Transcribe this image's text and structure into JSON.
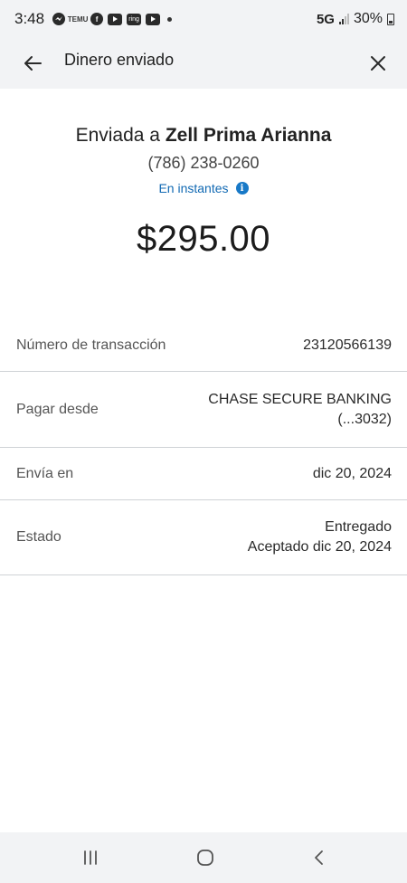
{
  "status_bar": {
    "time": "3:48",
    "icons": [
      "messenger-icon",
      "temu-icon",
      "facebook-icon",
      "youtube-icon",
      "ring-icon",
      "youtube-icon"
    ],
    "temu_text": "TEMU",
    "ring_text": "ring",
    "network": "5G",
    "battery": "30%"
  },
  "app_bar": {
    "title": "Dinero enviado",
    "back_icon": "arrow-left-icon",
    "close_icon": "close-icon"
  },
  "summary": {
    "sent_prefix": "Enviada a ",
    "recipient_name": "Zell Prima Arianna",
    "phone": "(786) 238-0260",
    "speed": "En instantes",
    "info_icon": "info-icon",
    "amount": "$295.00"
  },
  "details": [
    {
      "label": "Número de transacción",
      "value": [
        "23120566139"
      ]
    },
    {
      "label": "Pagar desde",
      "value": [
        "CHASE SECURE BANKING",
        "(...3032)"
      ]
    },
    {
      "label": "Envía en",
      "value": [
        "dic 20, 2024"
      ]
    },
    {
      "label": "Estado",
      "value": [
        "Entregado",
        "Aceptado dic 20, 2024"
      ]
    }
  ],
  "nav_bar": {
    "icons": [
      "recent-apps-icon",
      "home-icon",
      "back-icon"
    ]
  },
  "colors": {
    "bar_background": "#f2f3f5",
    "link_blue": "#1169b3",
    "divider": "#cfd2d6"
  }
}
